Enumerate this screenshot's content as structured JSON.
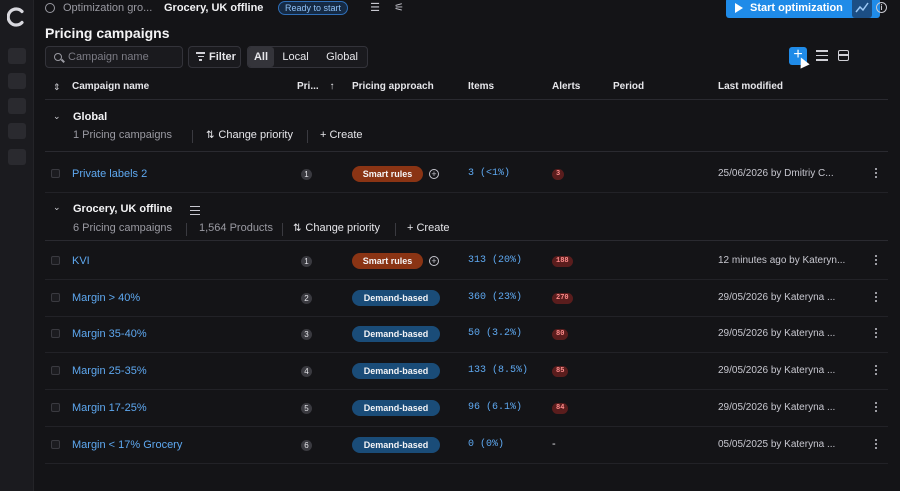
{
  "breadcrumb": {
    "parent": "Optimization gro...",
    "current": "Grocery, UK offline",
    "status": "Ready to start"
  },
  "actions": {
    "start_label": "Start optimization"
  },
  "page_title": "Pricing campaigns",
  "toolbar": {
    "search_placeholder": "Campaign name",
    "filter_label": "Filter",
    "scope_tabs": [
      {
        "label": "All",
        "active": true
      },
      {
        "label": "Local",
        "active": false
      },
      {
        "label": "Global",
        "active": false
      }
    ]
  },
  "columns": [
    "Campaign name",
    "Pri...",
    "Pricing approach",
    "Items",
    "Alerts",
    "Period",
    "Last modified"
  ],
  "groups": [
    {
      "title": "Global",
      "count_text": "1 Pricing campaigns",
      "products_text": "",
      "change_priority_label": "Change priority",
      "create_label": "+ Create",
      "rows": [
        {
          "name": "Private labels 2",
          "priority": "1",
          "approach": "Smart rules",
          "approach_type": "smart",
          "items": "3 (<1%)",
          "alerts": "3",
          "period": "",
          "modified": "25/06/2026 by Dmitriy C..."
        }
      ]
    },
    {
      "title": "Grocery, UK offline",
      "count_text": "6 Pricing campaigns",
      "products_text": "1,564 Products",
      "change_priority_label": "Change priority",
      "create_label": "+ Create",
      "rows": [
        {
          "name": "KVI",
          "priority": "1",
          "approach": "Smart rules",
          "approach_type": "smart",
          "items": "313 (20%)",
          "alerts": "188",
          "period": "",
          "modified": "12 minutes ago by Kateryn..."
        },
        {
          "name": "Margin > 40%",
          "priority": "2",
          "approach": "Demand-based",
          "approach_type": "demand",
          "items": "360 (23%)",
          "alerts": "270",
          "period": "",
          "modified": "29/05/2026 by Kateryna ..."
        },
        {
          "name": "Margin 35-40%",
          "priority": "3",
          "approach": "Demand-based",
          "approach_type": "demand",
          "items": "50 (3.2%)",
          "alerts": "80",
          "period": "",
          "modified": "29/05/2026 by Kateryna ..."
        },
        {
          "name": "Margin 25-35%",
          "priority": "4",
          "approach": "Demand-based",
          "approach_type": "demand",
          "items": "133 (8.5%)",
          "alerts": "85",
          "period": "",
          "modified": "29/05/2026 by Kateryna ..."
        },
        {
          "name": "Margin 17-25%",
          "priority": "5",
          "approach": "Demand-based",
          "approach_type": "demand",
          "items": "96 (6.1%)",
          "alerts": "84",
          "period": "",
          "modified": "29/05/2026 by Kateryna ..."
        },
        {
          "name": "Margin < 17% Grocery",
          "priority": "6",
          "approach": "Demand-based",
          "approach_type": "demand",
          "items": "0 (0%)",
          "alerts": "-",
          "period": "",
          "modified": "05/05/2025 by Kateryna ..."
        }
      ]
    }
  ],
  "colors": {
    "accent": "#1f8be8",
    "link": "#5ea8f0",
    "smart_pill": "#8a3414",
    "demand_pill": "#1a4c78",
    "alert_bg": "#5a1d1d",
    "alert_text": "#ff8c8c",
    "background": "#141417"
  }
}
